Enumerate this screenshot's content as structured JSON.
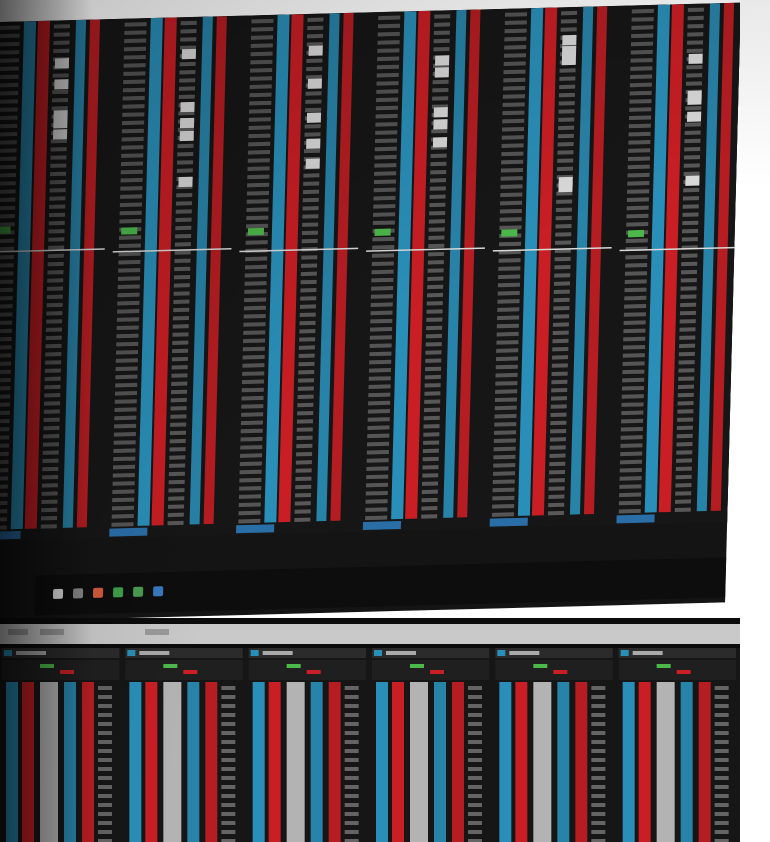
{
  "image": {
    "subject": "photograph-of-trading-monitors",
    "colors": {
      "bid": "#2a8fb8",
      "ask": "#c81e24",
      "background": "#161616",
      "highlight": "#4cb84a",
      "cell": "#d9d9d9"
    },
    "upper_monitor": {
      "ladders": 6,
      "footer_tabs": 6
    },
    "lower_monitor": {
      "ladders": 6
    }
  }
}
